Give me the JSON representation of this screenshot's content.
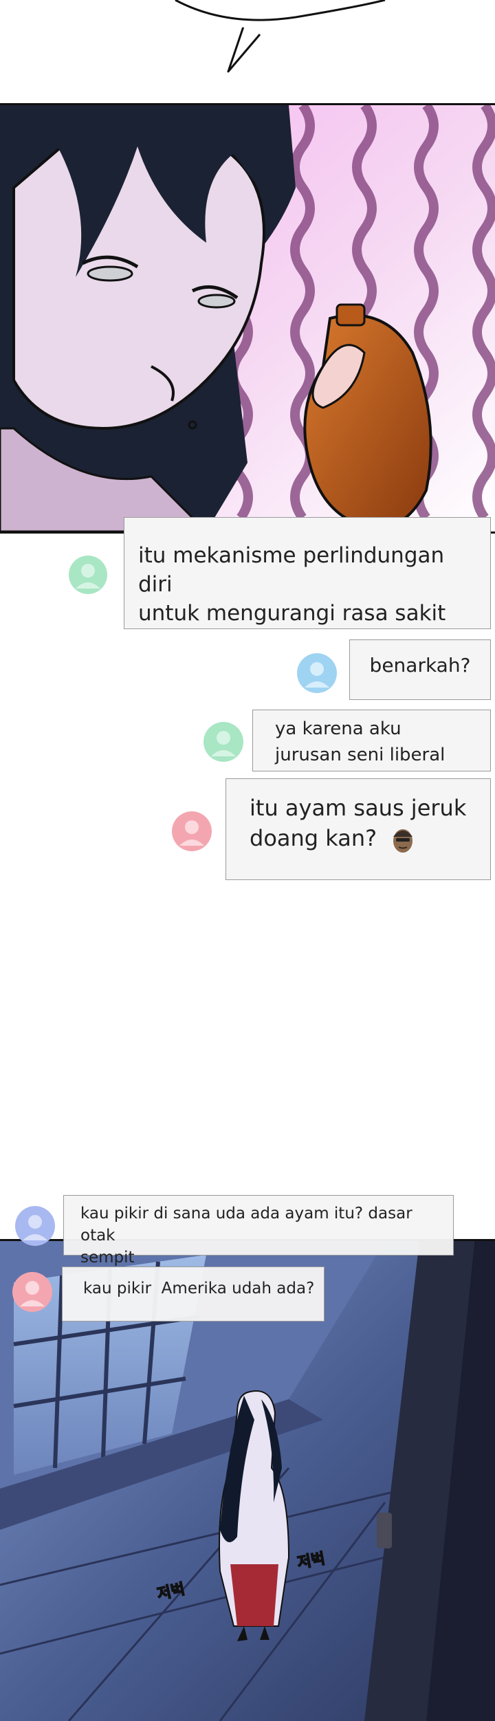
{
  "chat": {
    "messages": [
      {
        "text_line1": "itu mekanisme perlindungan diri",
        "text_line2": "untuk mengurangi rasa sakit",
        "avatar_color": "#a8e6c4"
      },
      {
        "text": "benarkah?",
        "avatar_color": "#9fd3f2"
      },
      {
        "text_line1": "ya karena aku",
        "text_line2": "jurusan seni liberal",
        "avatar_color": "#a8e6c4"
      },
      {
        "text_line1": "itu ayam saus jeruk",
        "text_line2": "doang kan?",
        "avatar_color": "#f4a6b0",
        "emoji": "face-emoji"
      },
      {
        "text_line1": "kau pikir di sana uda ada ayam itu? dasar otak",
        "text_line2": "sempit",
        "avatar_color": "#a8b8f0"
      },
      {
        "text": "kau pikir  Amerika udah ada?",
        "avatar_color": "#f4a6b0"
      }
    ]
  },
  "sfx": {
    "left": "저벅",
    "right": "저벅"
  },
  "colors": {
    "panel_bg_pink": "#f0c8ee",
    "wavy_lines": "#8a3b7c",
    "hair": "#1b2233",
    "skin": "#e7d3e6",
    "chicken": "#c2601a",
    "night_blue": "#3f5382"
  }
}
